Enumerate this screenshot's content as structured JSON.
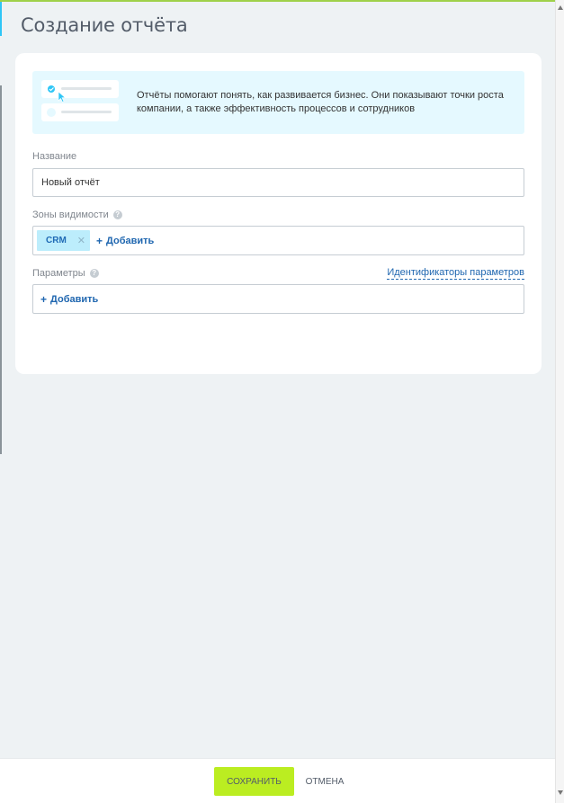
{
  "page": {
    "title": "Создание отчёта"
  },
  "banner": {
    "text": "Отчёты помогают понять, как развивается бизнес. Они показывают точки роста компании, а также эффективность процессов и сотрудников"
  },
  "form": {
    "name_label": "Название",
    "name_value": "Новый отчёт",
    "visibility_label": "Зоны видимости",
    "visibility_tags": [
      "CRM"
    ],
    "visibility_add": "Добавить",
    "params_label": "Параметры",
    "params_identifiers_link": "Идентификаторы параметров",
    "params_add": "Добавить"
  },
  "footer": {
    "save_label": "Сохранить",
    "cancel_label": "ОТМЕНА"
  },
  "colors": {
    "accent_green": "#bbed21",
    "link_blue": "#2067b0",
    "banner_bg": "#e5f9ff",
    "tag_bg": "#bcedfc",
    "page_bg": "#eef2f4"
  },
  "icons": {
    "help": "question-circle-icon",
    "remove": "close-icon",
    "add": "plus-icon",
    "illustration": "report-illustration"
  }
}
